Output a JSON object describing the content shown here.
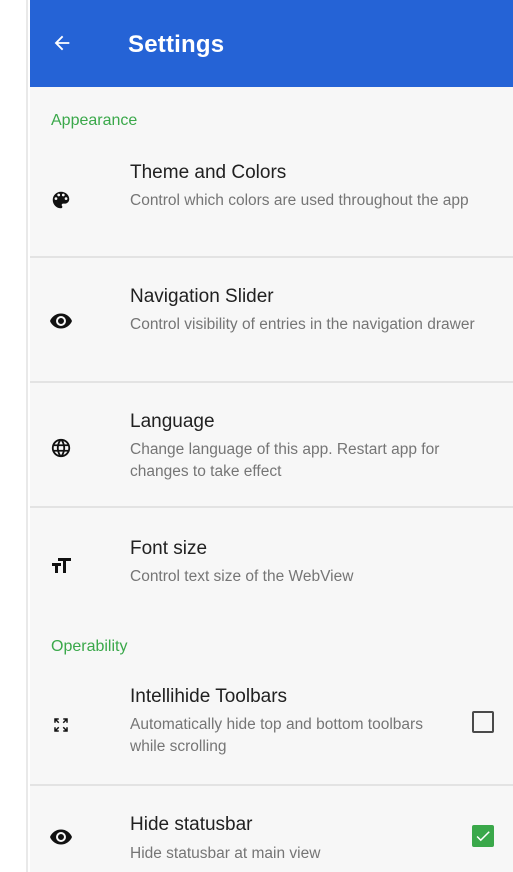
{
  "app_bar": {
    "title": "Settings",
    "back_icon": "arrow-back-icon",
    "color": "#2563d6"
  },
  "sections": [
    {
      "header": "Appearance",
      "items": [
        {
          "icon": "palette-icon",
          "title": "Theme and Colors",
          "summary": "Control which colors are used throughout the app"
        },
        {
          "icon": "eye-icon",
          "title": "Navigation Slider",
          "summary": "Control visibility of entries in the navigation drawer"
        },
        {
          "icon": "globe-icon",
          "title": "Language",
          "summary": "Change language of this app. Restart app for changes to take effect"
        },
        {
          "icon": "text-size-icon",
          "title": "Font size",
          "summary": "Control text size of the WebView"
        }
      ]
    },
    {
      "header": "Operability",
      "items": [
        {
          "icon": "fullscreen-icon",
          "title": "Intellihide Toolbars",
          "summary": "Automatically hide top and bottom toolbars while scrolling",
          "checked": false
        },
        {
          "icon": "eye-icon",
          "title": "Hide statusbar",
          "summary": "Hide statusbar at main view",
          "checked": true
        }
      ]
    }
  ],
  "colors": {
    "accent": "#3aa84a",
    "primary": "#2563d6"
  }
}
